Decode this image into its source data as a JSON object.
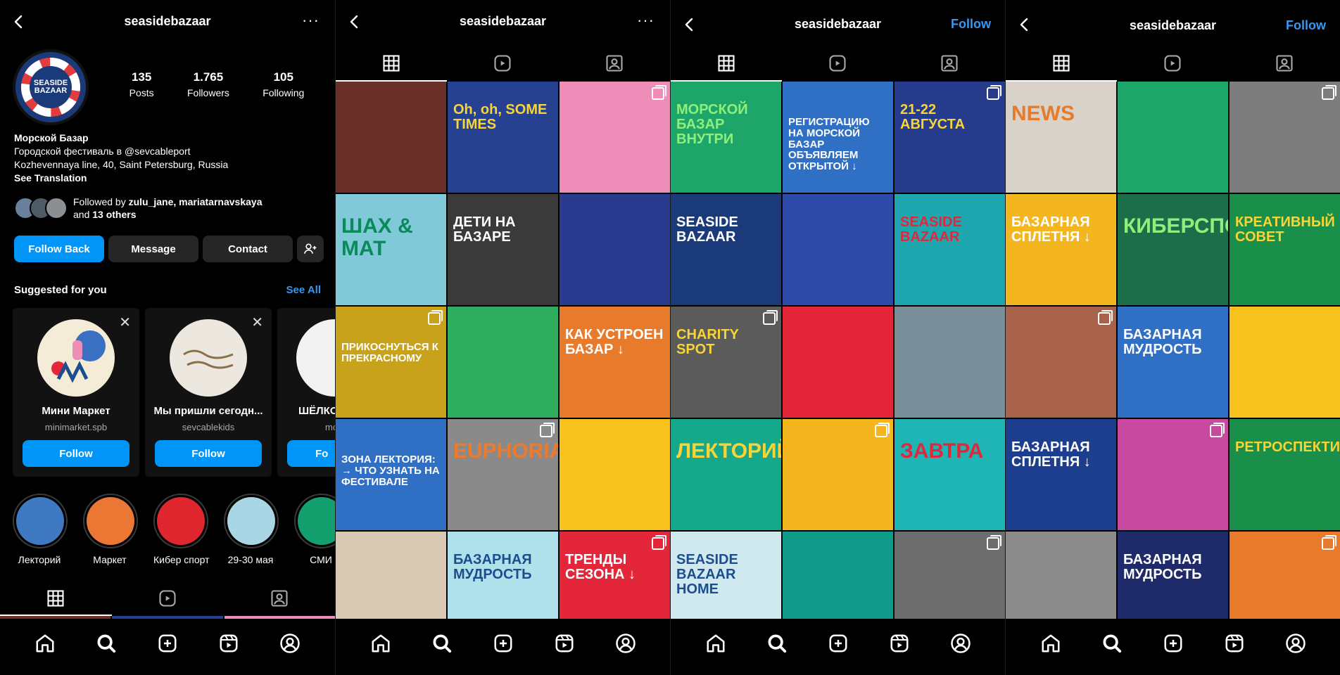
{
  "colors": {
    "accent": "#0095f6",
    "link": "#3897f0",
    "background": "#000000"
  },
  "profile": {
    "username": "seasidebazaar",
    "more_icon": "more-icon",
    "avatar_text": "SEASIDE BAZAAR",
    "stats": [
      {
        "value": "135",
        "label": "Posts"
      },
      {
        "value": "1.765",
        "label": "Followers"
      },
      {
        "value": "105",
        "label": "Following"
      }
    ],
    "bio": {
      "name": "Морской Базар",
      "line1": "Городской фестиваль в @sevcableport",
      "line2": "Kozhevennaya line, 40, Saint Petersburg, Russia",
      "translate": "See Translation"
    },
    "followed_by": {
      "prefix": "Followed by ",
      "users": "zulu_jane, mariatarnavskaya",
      "and": "and ",
      "others": "13 others"
    },
    "buttons": {
      "follow_back": "Follow Back",
      "message": "Message",
      "contact": "Contact"
    },
    "suggested": {
      "title": "Suggested for you",
      "see_all": "See All",
      "cards": [
        {
          "name": "Мини Маркет",
          "user": "minimarket.spb",
          "button": "Follow"
        },
        {
          "name": "Мы пришли сегодн...",
          "user": "sevcablekids",
          "button": "Follow"
        },
        {
          "name": "ШЁЛКОВЫЙ",
          "user": "moon",
          "button": "Fo"
        }
      ]
    },
    "highlights": [
      {
        "label": "Лекторий",
        "color": "#3f79c1"
      },
      {
        "label": "Маркет",
        "color": "#ec7734"
      },
      {
        "label": "Кибер спорт",
        "color": "#e0262f"
      },
      {
        "label": "29-30 мая",
        "color": "#a9d6e4"
      },
      {
        "label": "СМИ",
        "color": "#14a06e"
      }
    ]
  },
  "panels_top": [
    {
      "title": "seasidebazaar",
      "right": "···"
    },
    {
      "title": "seasidebazaar",
      "right": "Follow"
    },
    {
      "title": "seasidebazaar",
      "right": "Follow"
    }
  ],
  "grid2": [
    {
      "bg": "#6b2f2a",
      "text": ""
    },
    {
      "bg": "#26418f",
      "text": "Oh, oh, SOME TIMES",
      "color": "#f7d437"
    },
    {
      "bg": "#ee8db8",
      "text": ""
    },
    {
      "bg": "#7fc9d8",
      "text": "ШАХ & МАТ",
      "color": "#0a8a5a"
    },
    {
      "bg": "#3a3a3a",
      "text": "ДЕТИ НА БАЗАРЕ",
      "color": "#ffffff"
    },
    {
      "bg": "#2a3b8f",
      "text": "",
      "color": "#ffffff"
    },
    {
      "bg": "#c9a21c",
      "text": "ПРИКОСНУТЬСЯ К ПРЕКРАСНОМУ",
      "color": "#ffffff"
    },
    {
      "bg": "#2fae62",
      "text": "",
      "color": "#ffffff"
    },
    {
      "bg": "#e87a2b",
      "text": "КАК УСТРОЕН БАЗАР ↓",
      "color": "#ffffff"
    },
    {
      "bg": "#2f6fc4",
      "text": "ЗОНА ЛЕКТОРИЯ: → ЧТО УЗНАТЬ НА ФЕСТИВАЛЕ",
      "color": "#ffffff"
    },
    {
      "bg": "#8a8a8a",
      "text": "EUPHORIA",
      "color": "#ef7a2c"
    },
    {
      "bg": "#f6c21b",
      "text": "",
      "color": "#ffffff"
    },
    {
      "bg": "#d9c9b4",
      "text": "",
      "color": "#ffffff"
    },
    {
      "bg": "#aee1ea",
      "text": "БАЗАРНАЯ МУДРОСТЬ",
      "color": "#1c4d8f"
    },
    {
      "bg": "#e3263a",
      "text": "ТРЕНДЫ СЕЗОНА ↓",
      "color": "#ffffff"
    }
  ],
  "grid3": [
    {
      "bg": "#1ea56a",
      "text": "МОРСКОЙ БАЗАР ВНУТРИ",
      "color": "#8ef07a"
    },
    {
      "bg": "#2f6fc4",
      "text": "РЕГИСТРАЦИЮ НА МОРСКОЙ БАЗАР ОБЪЯВЛЯЕМ ОТКРЫТОЙ ↓",
      "color": "#ffffff"
    },
    {
      "bg": "#263b8c",
      "text": "21-22 АВГУСТА",
      "color": "#f7d437"
    },
    {
      "bg": "#1a3a7a",
      "text": "SEASIDE BAZAAR",
      "color": "#ffffff"
    },
    {
      "bg": "#2d4aa8",
      "text": "",
      "color": "#ffffff"
    },
    {
      "bg": "#1fa7b0",
      "text": "SEASIDE BAZAAR",
      "color": "#e3263a"
    },
    {
      "bg": "#5b5b5b",
      "text": "CHARITY SPOT",
      "color": "#f7d437"
    },
    {
      "bg": "#e3263a",
      "text": "",
      "color": "#ffffff"
    },
    {
      "bg": "#7a8f9a",
      "text": "",
      "color": "#ffffff"
    },
    {
      "bg": "#16a88a",
      "text": "ЛЕКТОРИЙ",
      "color": "#f7d437"
    },
    {
      "bg": "#f3b61f",
      "text": "",
      "color": "#ffffff"
    },
    {
      "bg": "#1fb5b5",
      "text": "ЗАВТРА",
      "color": "#e3263a"
    },
    {
      "bg": "#cfe9ee",
      "text": "SEASIDE BAZAAR HOME",
      "color": "#1c4d8f"
    },
    {
      "bg": "#0f9a8a",
      "text": "",
      "color": "#ffffff"
    },
    {
      "bg": "#6d6d6d",
      "text": "",
      "color": "#ffffff"
    }
  ],
  "grid4": [
    {
      "bg": "#d8d2c8",
      "text": "NEWS",
      "color": "#e87a2b"
    },
    {
      "bg": "#1ea56a",
      "text": "",
      "color": "#ffffff"
    },
    {
      "bg": "#7d7d7d",
      "text": "",
      "color": "#ffffff"
    },
    {
      "bg": "#f3b61f",
      "text": "БАЗАРНАЯ СПЛЕТНЯ ↓",
      "color": "#ffffff"
    },
    {
      "bg": "#1c6e4a",
      "text": "КИБЕРСПОРТ",
      "color": "#8ef07a"
    },
    {
      "bg": "#1a8f4a",
      "text": "КРЕАТИВНЫЙ СОВЕТ",
      "color": "#f7d437"
    },
    {
      "bg": "#a9624a",
      "text": "",
      "color": "#ffffff"
    },
    {
      "bg": "#2f6fc4",
      "text": "БАЗАРНАЯ МУДРОСТЬ",
      "color": "#ffffff"
    },
    {
      "bg": "#f6c21b",
      "text": "",
      "color": "#ffffff"
    },
    {
      "bg": "#1d3d8f",
      "text": "БАЗАРНАЯ СПЛЕТНЯ ↓",
      "color": "#ffffff"
    },
    {
      "bg": "#c84aa0",
      "text": "",
      "color": "#ffffff"
    },
    {
      "bg": "#1a8f4a",
      "text": "РЕТРОСПЕКТИВА",
      "color": "#f7d437"
    },
    {
      "bg": "#8b8b8b",
      "text": "",
      "color": "#ffffff"
    },
    {
      "bg": "#1f2a6b",
      "text": "БАЗАРНАЯ МУДРОСТЬ",
      "color": "#ffffff"
    },
    {
      "bg": "#e87a2b",
      "text": "",
      "color": "#ffffff"
    }
  ]
}
